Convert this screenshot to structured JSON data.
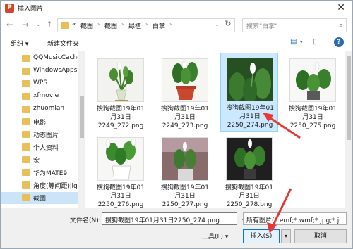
{
  "window": {
    "title": "插入图片",
    "app_icon_letter": "P"
  },
  "address": {
    "overflow": "«",
    "crumbs": [
      "截图",
      "截图",
      "绿植",
      "白掌"
    ]
  },
  "search": {
    "placeholder": "搜索\"白掌\""
  },
  "toolbar": {
    "organize": "组织 ▾",
    "new_folder": "新建文件夹"
  },
  "sidebar": {
    "items": [
      {
        "label": "QQMusicCache"
      },
      {
        "label": "WindowsApps"
      },
      {
        "label": "WPS"
      },
      {
        "label": "xfmovie"
      },
      {
        "label": "zhuomian"
      },
      {
        "label": "电影"
      },
      {
        "label": "动态图片"
      },
      {
        "label": "个人资料"
      },
      {
        "label": "宏"
      },
      {
        "label": "华为MATE9"
      },
      {
        "label": "角度(等间距)jig"
      },
      {
        "label": "截图"
      }
    ],
    "selected_index": 11
  },
  "files": [
    {
      "label": "搜狗截图19年01\n月31日\n2249_272.png",
      "selected": false
    },
    {
      "label": "搜狗截图19年01\n月31日\n2249_273.png",
      "selected": false
    },
    {
      "label": "搜狗截图19年01\n月31日\n2250_274.png",
      "selected": true
    },
    {
      "label": "搜狗截图19年01\n月31日\n2250_275.png",
      "selected": false
    },
    {
      "label": "搜狗截图19年01\n月31日\n2250_276.png",
      "selected": false
    },
    {
      "label": "搜狗截图19年01\n月31日\n2250_277.png",
      "selected": false
    },
    {
      "label": "搜狗截图19年01\n月31日\n2250_278.png",
      "selected": false
    }
  ],
  "bottom": {
    "filename_label": "文件名(N):",
    "filename_value": "搜狗截图19年01月31日2250_274.png",
    "filetype_value": "所有图片(*.emf;*.wmf;*.jpg;*.j",
    "tools_label": "工具(L)  ▾",
    "insert_label": "插入(S)",
    "cancel_label": "取消"
  },
  "colors": {
    "accent": "#0078d7",
    "selection": "#cce8ff",
    "annotation": "#e53935"
  }
}
